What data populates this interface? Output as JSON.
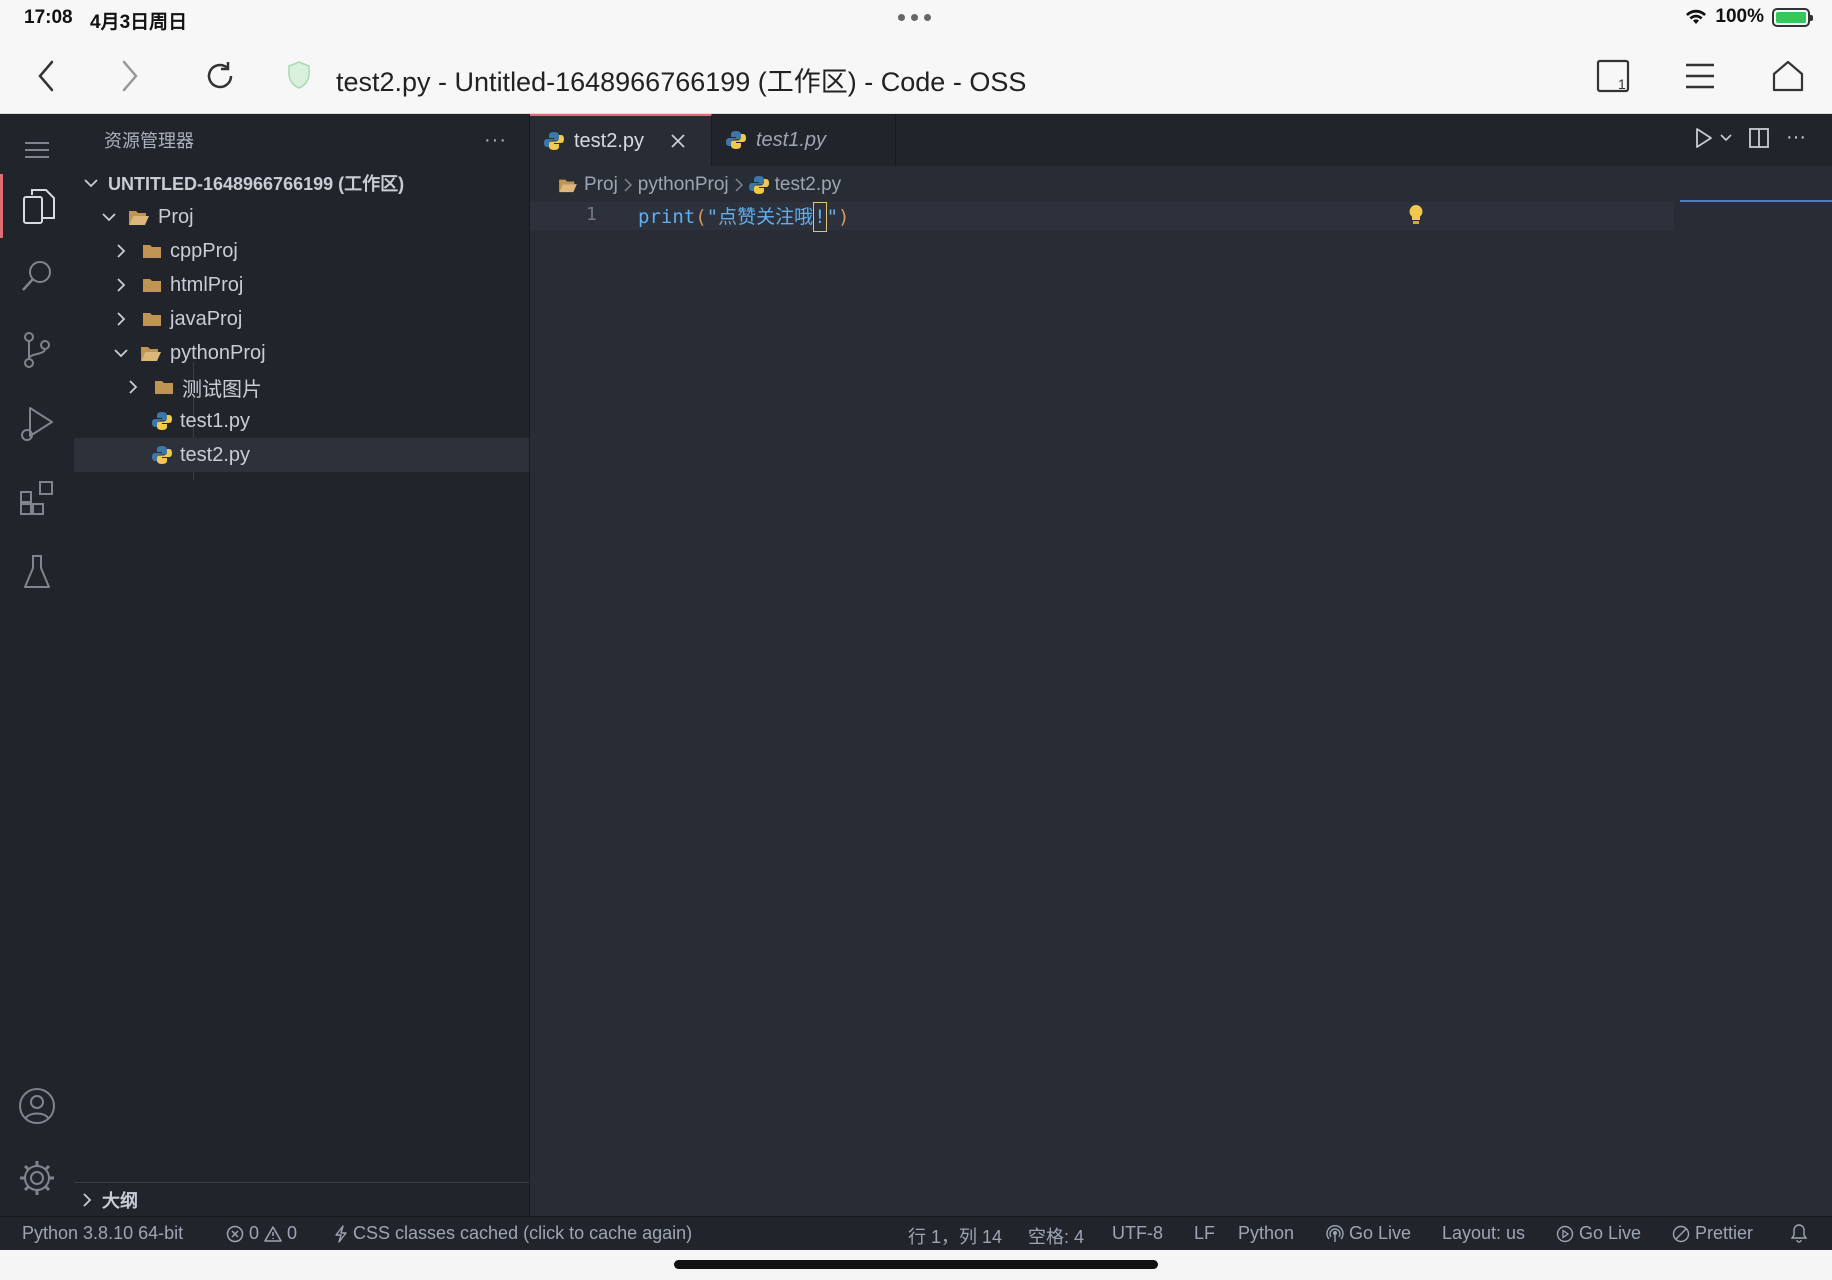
{
  "status_bar": {
    "time": "17:08",
    "date": "4月3日周日",
    "battery": "100%",
    "battery_level": 1.0
  },
  "browser": {
    "title": "test2.py - Untitled-1648966766199 (工作区) - Code - OSS",
    "icons": [
      "back-icon",
      "forward-icon",
      "reload-icon",
      "shield-icon",
      "tabs-icon",
      "menu-icon",
      "home-icon"
    ]
  },
  "activity_bar": {
    "items": [
      "explorer-icon",
      "search-icon",
      "source-control-icon",
      "run-debug-icon",
      "extensions-icon",
      "testing-icon"
    ],
    "bottom": [
      "accounts-icon",
      "settings-icon"
    ]
  },
  "sidebar": {
    "title": "资源管理器",
    "more": "···",
    "tree": [
      {
        "label": "UNTITLED-1648966766199 (工作区)",
        "type": "root",
        "expanded": true
      },
      {
        "label": "Proj",
        "type": "folder",
        "expanded": true
      },
      {
        "label": "cppProj",
        "type": "folder",
        "expanded": false
      },
      {
        "label": "htmlProj",
        "type": "folder",
        "expanded": false
      },
      {
        "label": "javaProj",
        "type": "folder",
        "expanded": false
      },
      {
        "label": "pythonProj",
        "type": "folder",
        "expanded": true
      },
      {
        "label": "测试图片",
        "type": "folder",
        "expanded": false
      },
      {
        "label": "test1.py",
        "type": "python-file"
      },
      {
        "label": "test2.py",
        "type": "python-file",
        "selected": true
      }
    ],
    "outline": "大纲"
  },
  "editor": {
    "tabs": [
      {
        "label": "test2.py",
        "active": true
      },
      {
        "label": "test1.py",
        "active": false,
        "preview": true
      }
    ],
    "breadcrumb": [
      "Proj",
      "pythonProj",
      "test2.py"
    ],
    "lines": [
      {
        "number": "1",
        "fn": "print",
        "open": "(",
        "str_open": "\"",
        "text": "点赞关注哦",
        "cursor_char": "!",
        "str_close": "\"",
        "close": ")"
      }
    ]
  },
  "status": {
    "python": "Python 3.8.10 64-bit",
    "errors": "0",
    "warnings": "0",
    "css": "CSS classes cached (click to cache again)",
    "position": "行 1，列 14",
    "spaces": "空格: 4",
    "encoding": "UTF-8",
    "eol": "LF",
    "language": "Python",
    "golive1": "Go Live",
    "layout": "Layout: us",
    "golive2": "Go Live",
    "prettier": "Prettier"
  },
  "colors": {
    "accent": "#e06c75",
    "editor_bg": "#282c34",
    "sidebar_bg": "#21252b",
    "folder": "#c09553"
  }
}
